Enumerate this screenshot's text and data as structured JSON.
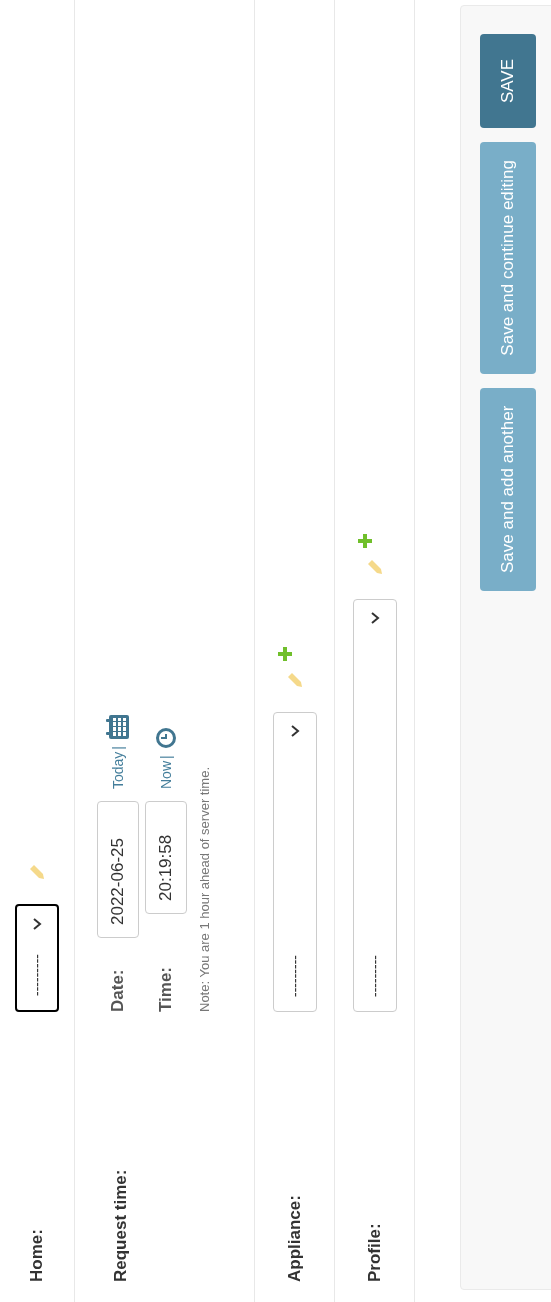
{
  "fields": [
    {
      "kind": "select",
      "label": "Home:",
      "value": "---------",
      "focused": true,
      "has_add": false
    },
    {
      "kind": "datetime",
      "label": "Request time:",
      "date_label": "Date:",
      "date_value": "2022-06-25",
      "today_link": "Today",
      "time_label": "Time:",
      "time_value": "20:19:58",
      "now_link": "Now",
      "separator": "|",
      "note": "Note: You are 1 hour ahead of server time."
    },
    {
      "kind": "select",
      "label": "Appliance:",
      "value": "---------",
      "focused": false,
      "has_add": true
    },
    {
      "kind": "select",
      "label": "Profile:",
      "value": "---------",
      "focused": false,
      "has_add": true
    }
  ],
  "buttons": [
    {
      "label": "Save and add another",
      "kind": "secondary"
    },
    {
      "label": "Save and continue editing",
      "kind": "secondary"
    },
    {
      "label": "SAVE",
      "kind": "primary"
    }
  ]
}
